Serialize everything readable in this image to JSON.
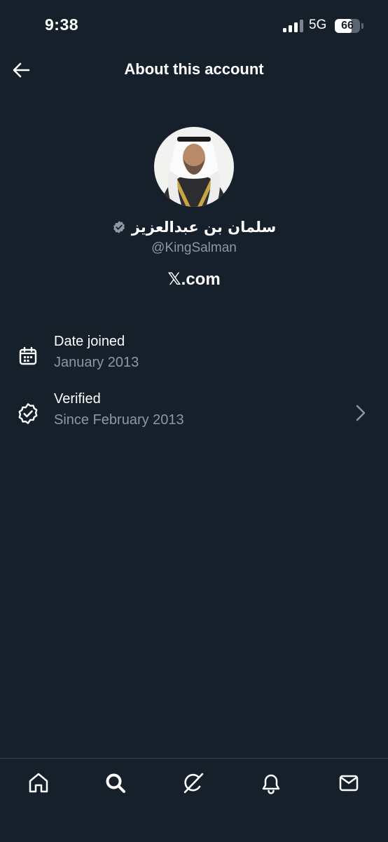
{
  "status_bar": {
    "time": "9:38",
    "network": "5G",
    "battery_level": "66",
    "battery_fraction": 0.66
  },
  "header": {
    "title": "About this account",
    "back_icon": "arrow-left-icon"
  },
  "profile": {
    "display_name": "سلمان بن عبدالعزيز",
    "handle": "@KingSalman",
    "verified_badge_color": "#8b98a5",
    "platform": "𝕏.com"
  },
  "details": [
    {
      "icon": "calendar-icon",
      "label": "Date joined",
      "value": "January 2013"
    },
    {
      "icon": "verified-badge-icon",
      "label": "Verified",
      "value": "Since February 2013"
    }
  ],
  "tabbar": {
    "items": [
      "home-icon",
      "search-icon",
      "grok-icon",
      "notifications-bell-icon",
      "messages-mail-icon"
    ]
  },
  "colors": {
    "background": "#15202b",
    "text_primary": "#ffffff",
    "text_secondary": "#8b98a5",
    "divider": "#38444d"
  }
}
